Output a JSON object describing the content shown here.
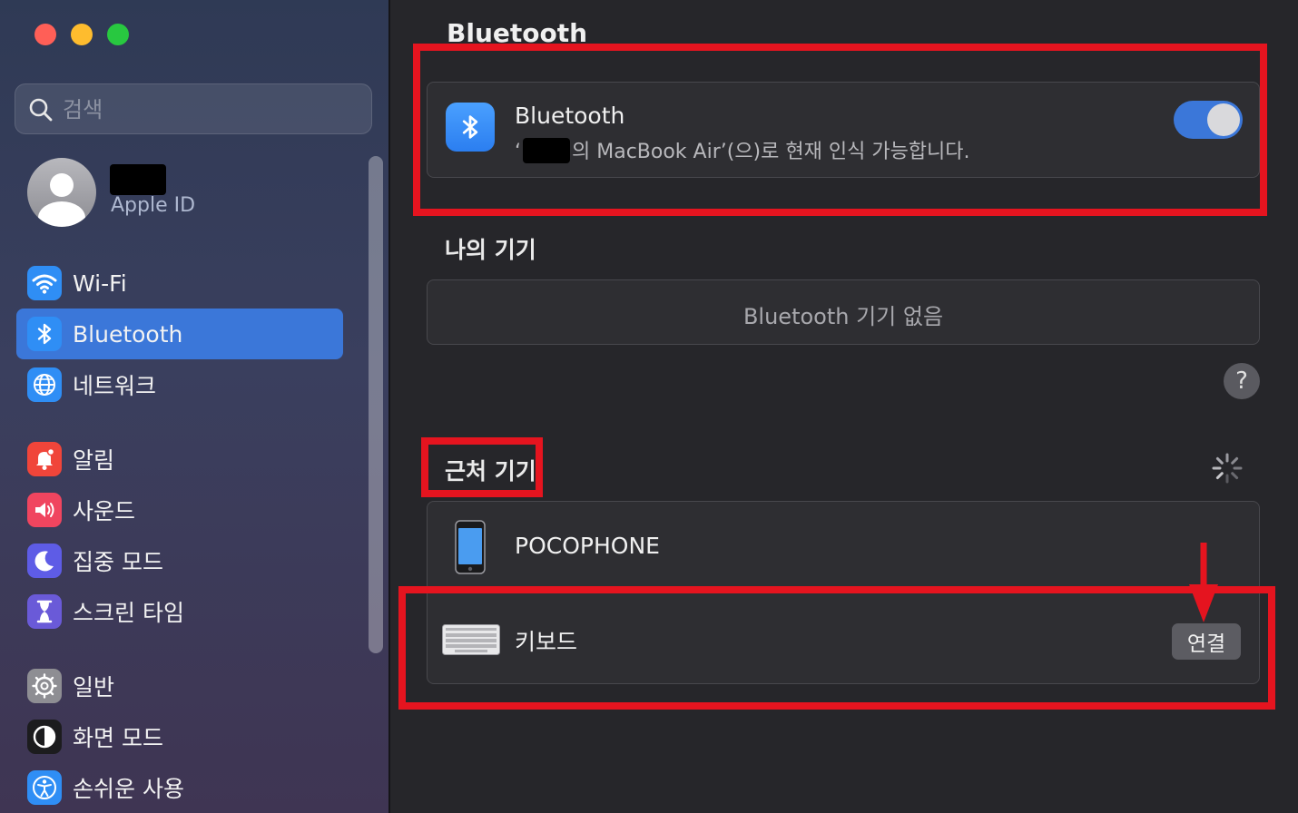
{
  "sidebar": {
    "search_placeholder": "검색",
    "account": {
      "label": "Apple ID"
    },
    "items": [
      {
        "label": "Wi-Fi",
        "icon": "wifi-icon",
        "color": "#2f8ef5"
      },
      {
        "label": "Bluetooth",
        "icon": "bluetooth-icon",
        "color": "#2f8ef5",
        "selected": true
      },
      {
        "label": "네트워크",
        "icon": "globe-icon",
        "color": "#2f8ef5"
      },
      {
        "label": "알림",
        "icon": "bell-icon",
        "color": "#f0453a"
      },
      {
        "label": "사운드",
        "icon": "speaker-icon",
        "color": "#f0455f"
      },
      {
        "label": "집중 모드",
        "icon": "moon-icon",
        "color": "#5e5ce6"
      },
      {
        "label": "스크린 타임",
        "icon": "hourglass-icon",
        "color": "#6a5ad8"
      },
      {
        "label": "일반",
        "icon": "gear-icon",
        "color": "#8e8e93"
      },
      {
        "label": "화면 모드",
        "icon": "appearance-icon",
        "color": "#1c1c1e"
      },
      {
        "label": "손쉬운 사용",
        "icon": "accessibility-icon",
        "color": "#2f8ef5"
      }
    ]
  },
  "main": {
    "title": "Bluetooth",
    "bluetooth": {
      "name": "Bluetooth",
      "status_prefix": "‘",
      "status_suffix": "의 MacBook Air’(으)로 현재 인식 가능합니다.",
      "enabled": true
    },
    "my_devices": {
      "heading": "나의 기기",
      "empty": "Bluetooth 기기 없음"
    },
    "help": "?",
    "nearby": {
      "heading": "근처 기기",
      "devices": [
        {
          "name": "POCOPHONE",
          "icon": "phone-icon"
        },
        {
          "name": "키보드",
          "icon": "keyboard-icon",
          "action": "연결"
        }
      ]
    }
  },
  "colors": {
    "accent": "#3b77d9",
    "highlight": "#e5141f"
  }
}
